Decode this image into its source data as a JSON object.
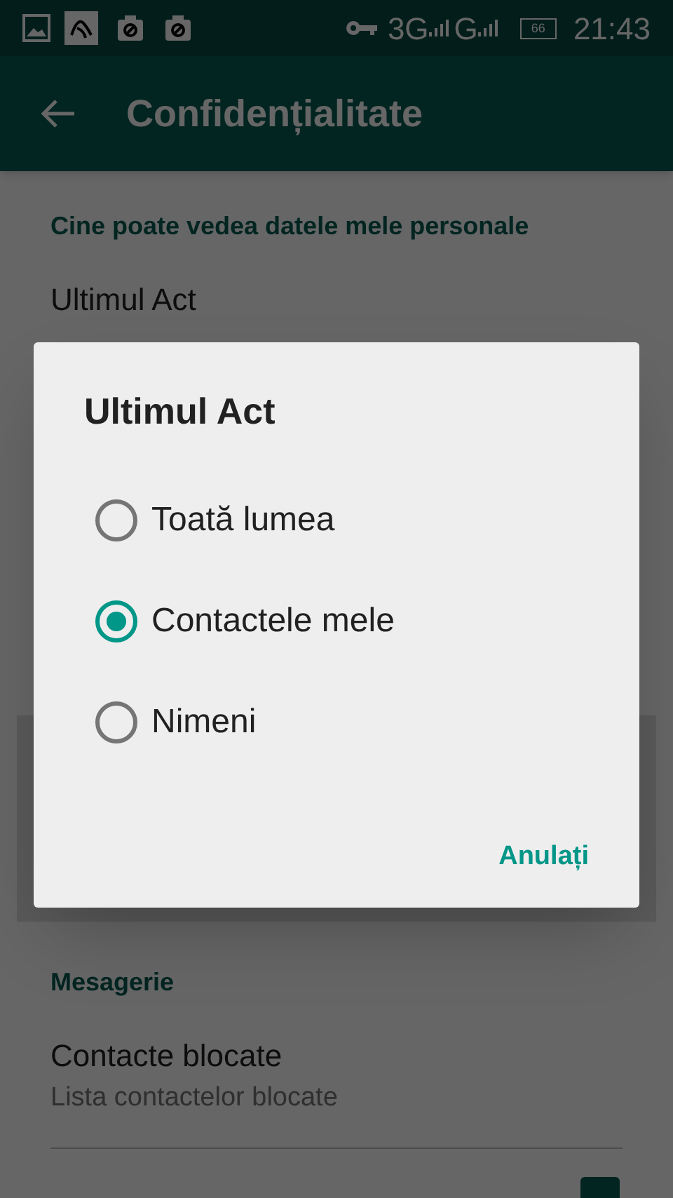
{
  "status_bar": {
    "network_1": "3G",
    "network_2": "G",
    "battery": "66",
    "time": "21:43"
  },
  "toolbar": {
    "title": "Confidențialitate"
  },
  "sections": [
    {
      "header": "Cine poate vedea datele mele personale",
      "items": [
        {
          "title": "Ultimul Act"
        }
      ]
    },
    {
      "header": "Mesagerie",
      "items": [
        {
          "kind": "link",
          "title": "Contacte blocate",
          "subtitle": "Lista contactelor blocate"
        },
        {
          "kind": "checkbox",
          "checked": true
        }
      ]
    }
  ],
  "dialog": {
    "title": "Ultimul Act",
    "options": [
      {
        "label": "Toată lumea",
        "selected": false
      },
      {
        "label": "Contactele mele",
        "selected": true
      },
      {
        "label": "Nimeni",
        "selected": false
      }
    ],
    "button": "Anulați"
  }
}
